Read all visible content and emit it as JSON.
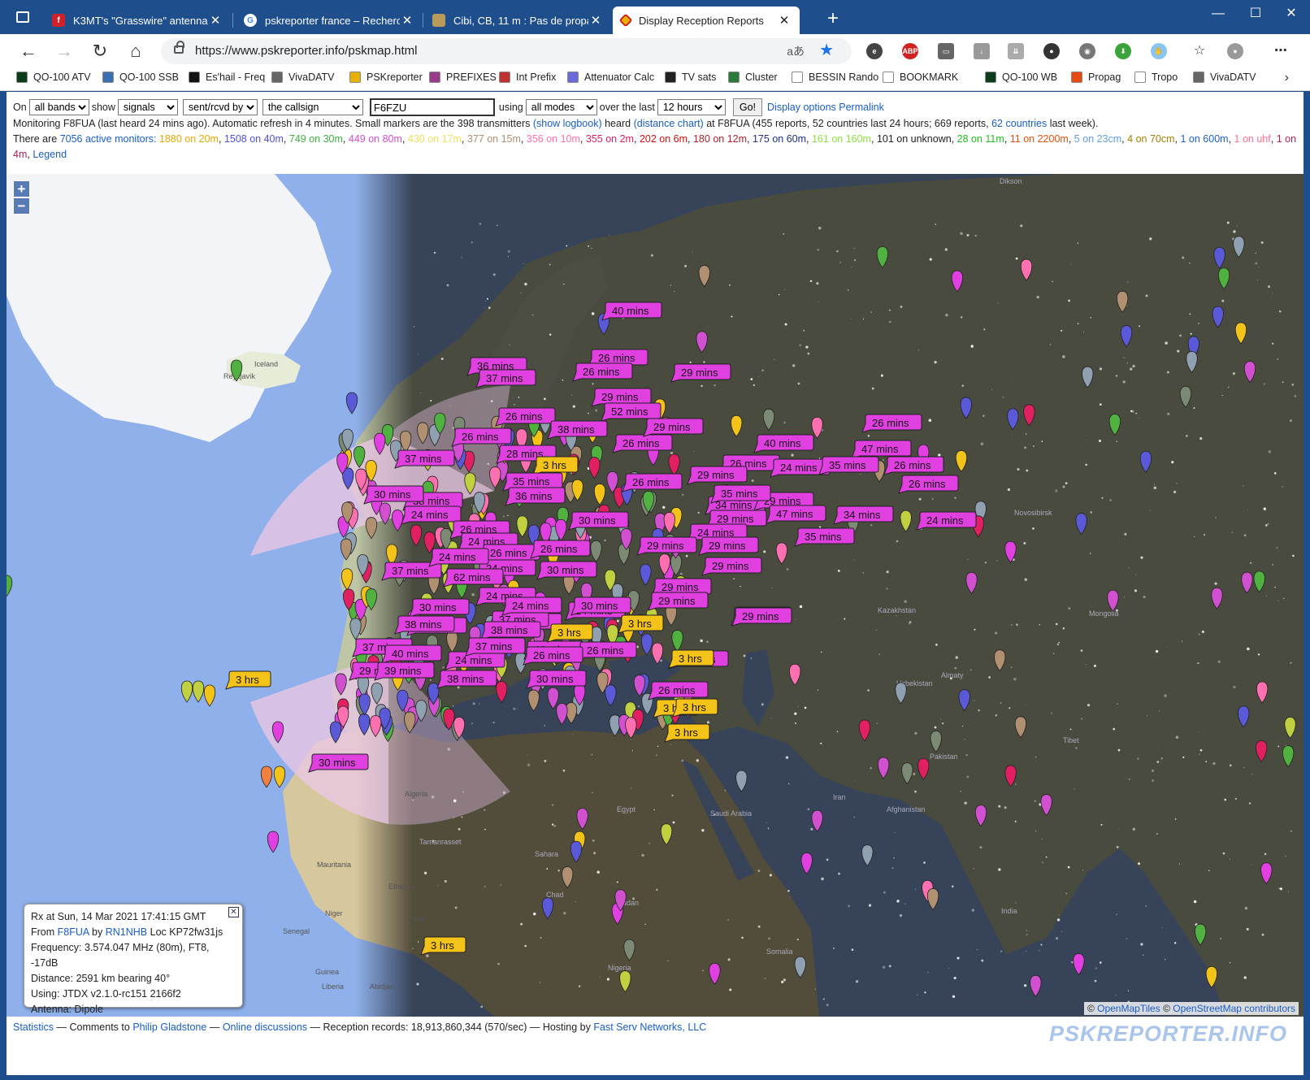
{
  "browser": {
    "tabs": [
      {
        "title": "K3MT's \"Grasswire\" antenna",
        "favicon_color": "#d0202a"
      },
      {
        "title": "pskreporter france – Recherche G",
        "favicon_color": "#4285f4"
      },
      {
        "title": "Cibi, CB, 11 m : Pas de propagati",
        "favicon_color": "#9a7b3a"
      },
      {
        "title": "Display Reception Reports",
        "favicon_color": "#e8b000",
        "active": true
      }
    ],
    "url": "https://www.pskreporter.info/pskmap.html",
    "bookmarks": [
      {
        "label": "QO-100 ATV",
        "color": "#0b3d1b"
      },
      {
        "label": "QO-100 SSB",
        "color": "#3b6fb0"
      },
      {
        "label": "Es'hail - Freq",
        "color": "#111111"
      },
      {
        "label": "VivaDATV",
        "color": "#666666"
      },
      {
        "label": "PSKreporter",
        "color": "#e8b000"
      },
      {
        "label": "PREFIXES",
        "color": "#9a3a8a"
      },
      {
        "label": "Int Prefix",
        "color": "#c03030"
      },
      {
        "label": "Attenuator Calc",
        "color": "#6a6adc"
      },
      {
        "label": "TV sats",
        "color": "#222222"
      },
      {
        "label": "Cluster",
        "color": "#2a7a3a"
      },
      {
        "label": "BESSIN Rando",
        "color": "#ffffff"
      },
      {
        "label": "BOOKMARK",
        "color": "#ffffff"
      },
      {
        "label": "QO-100 WB",
        "color": "#0b3d1b"
      },
      {
        "label": "Propag",
        "color": "#e84a10"
      },
      {
        "label": "Tropo",
        "color": "#ffffff"
      },
      {
        "label": "VivaDATV",
        "color": "#666666"
      }
    ]
  },
  "controls": {
    "on_label": "On",
    "band": "all bands",
    "show_label": "show",
    "show": "signals",
    "direction": "sent/rcvd by",
    "target": "the callsign",
    "callsign": "F6FZU",
    "using_label": "using",
    "modes": "all modes",
    "over_label": "over the last",
    "period": "12 hours",
    "go": "Go!",
    "display_options": "Display options",
    "permalink": "Permalink"
  },
  "status": {
    "line1_a": "Monitoring F8FUA (last heard 24 mins ago). Automatic refresh in 4 minutes. Small markers are the 398 transmitters",
    "show_logbook": "(show logbook)",
    "line1_b": "heard",
    "distance_chart": "(distance chart)",
    "line1_c": "at F8FUA (455 reports, 52 countries last 24 hours; 669 reports,",
    "countries_link": "62 countries",
    "line1_d": "last week).",
    "monitors_prefix": "There are",
    "monitors_link": "7056 active monitors:",
    "bands": [
      {
        "text": "1880 on 20m",
        "color": "#e8a800"
      },
      {
        "text": "1508 on 40m",
        "color": "#5050e0"
      },
      {
        "text": "749 on 30m",
        "color": "#40b040"
      },
      {
        "text": "449 on 80m",
        "color": "#d050d0"
      },
      {
        "text": "430 on 17m",
        "color": "#f0e060"
      },
      {
        "text": "377 on 15m",
        "color": "#b09070"
      },
      {
        "text": "356 on 10m",
        "color": "#ff70b0"
      },
      {
        "text": "355 on 2m",
        "color": "#e02060"
      },
      {
        "text": "202 on 6m",
        "color": "#d01010"
      },
      {
        "text": "180 on 12m",
        "color": "#b02030"
      },
      {
        "text": "175 on 60m",
        "color": "#203080"
      },
      {
        "text": "161 on 160m",
        "color": "#90e040"
      },
      {
        "text": "101 on unknown",
        "color": "#222222"
      },
      {
        "text": "28 on 11m",
        "color": "#20c020"
      },
      {
        "text": "11 on 2200m",
        "color": "#e05010"
      },
      {
        "text": "5 on 23cm",
        "color": "#60a0e0"
      },
      {
        "text": "4 on 70cm",
        "color": "#a08000"
      },
      {
        "text": "1 on 600m",
        "color": "#2060d0"
      },
      {
        "text": "1 on uhf",
        "color": "#ff7090"
      },
      {
        "text": "1 on 4m",
        "color": "#b02050"
      }
    ],
    "legend": "Legend"
  },
  "map": {
    "place_labels": [
      {
        "text": "Iceland"
      },
      {
        "text": "Reykjavík"
      },
      {
        "text": "Dikson"
      },
      {
        "text": "Kazakhstan"
      },
      {
        "text": "Mongolia"
      },
      {
        "text": "Algeria"
      },
      {
        "text": "Egypt"
      },
      {
        "text": "Chad"
      },
      {
        "text": "Sudan"
      },
      {
        "text": "Ethiopia"
      },
      {
        "text": "Mali"
      },
      {
        "text": "Niger"
      },
      {
        "text": "Senegal"
      },
      {
        "text": "Mauritania"
      },
      {
        "text": "Guinea"
      },
      {
        "text": "Nigeria"
      },
      {
        "text": "Sahara"
      },
      {
        "text": "Novosibirsk"
      },
      {
        "text": "Tamanrasset"
      },
      {
        "text": "India"
      },
      {
        "text": "Pakistan"
      },
      {
        "text": "Afghanistan"
      },
      {
        "text": "Iran"
      },
      {
        "text": "Saudi Arabia"
      },
      {
        "text": "Somalia"
      },
      {
        "text": "Liberia"
      },
      {
        "text": "Abidjan"
      },
      {
        "text": "Uzbekistan"
      },
      {
        "text": "Almaty"
      },
      {
        "text": "Tibet"
      }
    ],
    "time_labels": [
      {
        "text": "40 mins",
        "kind": "mins"
      },
      {
        "text": "26 mins",
        "kind": "mins"
      },
      {
        "text": "26 mins",
        "kind": "mins"
      },
      {
        "text": "29 mins",
        "kind": "mins"
      },
      {
        "text": "36 mins",
        "kind": "mins"
      },
      {
        "text": "37 mins",
        "kind": "mins"
      },
      {
        "text": "29 mins",
        "kind": "mins"
      },
      {
        "text": "26 mins",
        "kind": "mins"
      },
      {
        "text": "52 mins",
        "kind": "mins"
      },
      {
        "text": "26 mins",
        "kind": "mins"
      },
      {
        "text": "38 mins",
        "kind": "mins"
      },
      {
        "text": "26 mins",
        "kind": "mins"
      },
      {
        "text": "29 mins",
        "kind": "mins"
      },
      {
        "text": "40 mins",
        "kind": "mins"
      },
      {
        "text": "26 mins",
        "kind": "mins"
      },
      {
        "text": "37 mins",
        "kind": "mins"
      },
      {
        "text": "28 mins",
        "kind": "mins"
      },
      {
        "text": "47 mins",
        "kind": "mins"
      },
      {
        "text": "26 mins",
        "kind": "mins"
      },
      {
        "text": "24 mins",
        "kind": "mins"
      },
      {
        "text": "35 mins",
        "kind": "mins"
      },
      {
        "text": "26 mins",
        "kind": "mins"
      },
      {
        "text": "3 hrs",
        "kind": "hrs"
      },
      {
        "text": "35 mins",
        "kind": "mins"
      },
      {
        "text": "26 mins",
        "kind": "mins"
      },
      {
        "text": "29 mins",
        "kind": "mins"
      },
      {
        "text": "26 mins",
        "kind": "mins"
      },
      {
        "text": "38 mins",
        "kind": "mins"
      },
      {
        "text": "24 mins",
        "kind": "mins"
      },
      {
        "text": "34 mins",
        "kind": "mins"
      },
      {
        "text": "29 mins",
        "kind": "mins"
      },
      {
        "text": "47 mins",
        "kind": "mins"
      },
      {
        "text": "34 mins",
        "kind": "mins"
      },
      {
        "text": "24 mins",
        "kind": "mins"
      },
      {
        "text": "26 mins",
        "kind": "mins"
      },
      {
        "text": "30 mins",
        "kind": "mins"
      },
      {
        "text": "29 mins",
        "kind": "mins"
      },
      {
        "text": "24 mins",
        "kind": "mins"
      },
      {
        "text": "35 mins",
        "kind": "mins"
      },
      {
        "text": "24 mins",
        "kind": "mins"
      },
      {
        "text": "26 mins",
        "kind": "mins"
      },
      {
        "text": "29 mins",
        "kind": "mins"
      },
      {
        "text": "29 mins",
        "kind": "mins"
      },
      {
        "text": "26 mins",
        "kind": "mins"
      },
      {
        "text": "37 mins",
        "kind": "mins"
      },
      {
        "text": "24 mins",
        "kind": "mins"
      },
      {
        "text": "30 mins",
        "kind": "mins"
      },
      {
        "text": "29 mins",
        "kind": "mins"
      },
      {
        "text": "62 mins",
        "kind": "mins"
      },
      {
        "text": "24 mins",
        "kind": "mins"
      },
      {
        "text": "29 mins",
        "kind": "mins"
      },
      {
        "text": "30 mins",
        "kind": "mins"
      },
      {
        "text": "29 mins",
        "kind": "mins"
      },
      {
        "text": "24 mins",
        "kind": "mins"
      },
      {
        "text": "30 mins",
        "kind": "mins"
      },
      {
        "text": "3 hrs",
        "kind": "hrs"
      },
      {
        "text": "29 mins",
        "kind": "mins"
      },
      {
        "text": "38 mins",
        "kind": "mins"
      },
      {
        "text": "30 mins",
        "kind": "mins"
      },
      {
        "text": "37 mins",
        "kind": "mins"
      },
      {
        "text": "40 mins",
        "kind": "mins"
      },
      {
        "text": "40 mins",
        "kind": "mins"
      },
      {
        "text": "26 mins",
        "kind": "mins"
      },
      {
        "text": "24 mins",
        "kind": "mins"
      },
      {
        "text": "62 mins",
        "kind": "mins"
      },
      {
        "text": "29 mins",
        "kind": "mins"
      },
      {
        "text": "39 mins",
        "kind": "mins"
      },
      {
        "text": "38 mins",
        "kind": "mins"
      },
      {
        "text": "30 mins",
        "kind": "mins"
      },
      {
        "text": "26 mins",
        "kind": "mins"
      },
      {
        "text": "3 hrs",
        "kind": "hrs"
      },
      {
        "text": "30 mins",
        "kind": "mins"
      },
      {
        "text": "3 hrs",
        "kind": "hrs"
      },
      {
        "text": "3 hrs",
        "kind": "hrs"
      },
      {
        "text": "3 hrs",
        "kind": "hrs"
      },
      {
        "text": "30 mins",
        "kind": "mins"
      },
      {
        "text": "3 hrs",
        "kind": "hrs"
      },
      {
        "text": "37 mins",
        "kind": "mins"
      },
      {
        "text": "3 hrs",
        "kind": "hrs"
      },
      {
        "text": "24 mins",
        "kind": "mins"
      },
      {
        "text": "38 mins",
        "kind": "mins"
      },
      {
        "text": "36 mins",
        "kind": "mins"
      },
      {
        "text": "30 mins",
        "kind": "mins"
      },
      {
        "text": "24 mins",
        "kind": "mins"
      },
      {
        "text": "35 mins",
        "kind": "mins"
      },
      {
        "text": "29 mins",
        "kind": "mins"
      },
      {
        "text": "3 hrs",
        "kind": "hrs"
      },
      {
        "text": "37 mins",
        "kind": "mins"
      },
      {
        "text": "26 mins",
        "kind": "mins"
      }
    ],
    "label_colors": {
      "mins": "#e040e0",
      "hrs": "#f3c31a"
    },
    "popup": {
      "line1": "Rx at Sun, 14 Mar 2021 17:41:15 GMT",
      "from_prefix": "From",
      "from_call": "F8FUA",
      "by_prefix": "by",
      "by_call": "RN1NHB",
      "loc": "Loc KP72fw31js",
      "frequency": "Frequency: 3.574.047 MHz (80m), FT8, -17dB",
      "distance": "Distance: 2591 km bearing 40°",
      "using": "Using: JTDX v2.1.0-rc151 2166f2",
      "antenna": "Antenna: Dipole"
    },
    "attribution": {
      "prefix": "©",
      "tiles": "OpenMapTiles",
      "osm": "OpenStreetMap contributors"
    }
  },
  "footer": {
    "statistics": "Statistics",
    "sep1": "—",
    "comments": "Comments to",
    "author": "Philip Gladstone",
    "sep2": "—",
    "online": "Online discussions",
    "sep3": "—",
    "records": "Reception records: 18,913,860,344 (570/sec)",
    "sep4": "— Hosting by",
    "host": "Fast Serv Networks, LLC",
    "brand": "PSKREPORTER.INFO"
  }
}
